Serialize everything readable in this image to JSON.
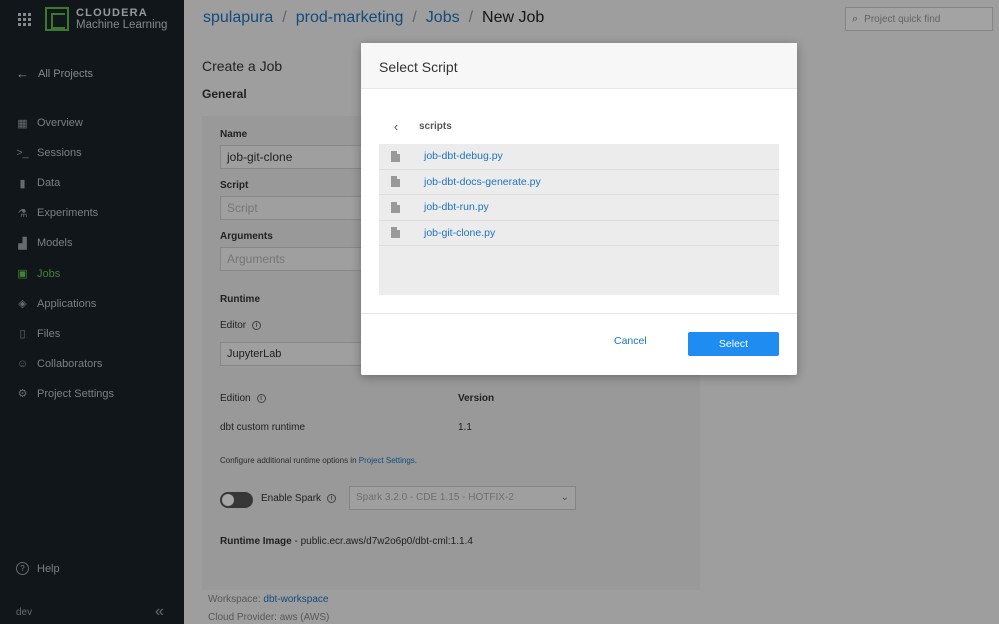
{
  "brand": {
    "line1": "CLOUDERA",
    "line2": "Machine Learning",
    "accent": "#64c64e"
  },
  "sidebar": {
    "back_label": "All Projects",
    "items": [
      {
        "label": "Overview",
        "icon": "overview-icon"
      },
      {
        "label": "Sessions",
        "icon": "terminal-icon"
      },
      {
        "label": "Data",
        "icon": "bar-chart-icon"
      },
      {
        "label": "Experiments",
        "icon": "flask-icon"
      },
      {
        "label": "Models",
        "icon": "models-icon"
      },
      {
        "label": "Jobs",
        "icon": "jobs-icon",
        "active": true
      },
      {
        "label": "Applications",
        "icon": "layers-icon"
      },
      {
        "label": "Files",
        "icon": "file-icon"
      },
      {
        "label": "Collaborators",
        "icon": "users-icon"
      },
      {
        "label": "Project Settings",
        "icon": "gear-icon"
      }
    ],
    "help_label": "Help",
    "user_label": "dev"
  },
  "header": {
    "breadcrumb": [
      "spulapura",
      "prod-marketing",
      "Jobs",
      "New Job"
    ],
    "search_placeholder": "Project quick find"
  },
  "page": {
    "title": "Create a Job",
    "section": "General",
    "name_label": "Name",
    "name_value": "job-git-clone",
    "script_label": "Script",
    "script_placeholder": "Script",
    "arguments_label": "Arguments",
    "arguments_placeholder": "Arguments",
    "runtime_label": "Runtime",
    "editor_label": "Editor",
    "editor_value": "JupyterLab",
    "edition_label": "Edition",
    "version_label": "Version",
    "edition_value": "dbt custom runtime",
    "version_value": "1.1",
    "config_text": "Configure additional runtime options in",
    "config_link": "Project Settings.",
    "spark_label": "Enable Spark",
    "spark_select": "Spark 3.2.0 - CDE 1.15 - HOTFIX-2",
    "runtime_image_label": "Runtime Image",
    "runtime_image_value": " - public.ecr.aws/d7w2o6p0/dbt-cml:1.1.4",
    "workspace_label": "Workspace:",
    "workspace_value": "dbt-workspace",
    "cloud_label": "Cloud Provider:",
    "cloud_value": "aws",
    "cloud_paren": "(AWS)"
  },
  "modal": {
    "title": "Select Script",
    "directory": "scripts",
    "files": [
      "job-dbt-debug.py",
      "job-dbt-docs-generate.py",
      "job-dbt-run.py",
      "job-git-clone.py"
    ],
    "cancel_label": "Cancel",
    "select_label": "Select"
  }
}
